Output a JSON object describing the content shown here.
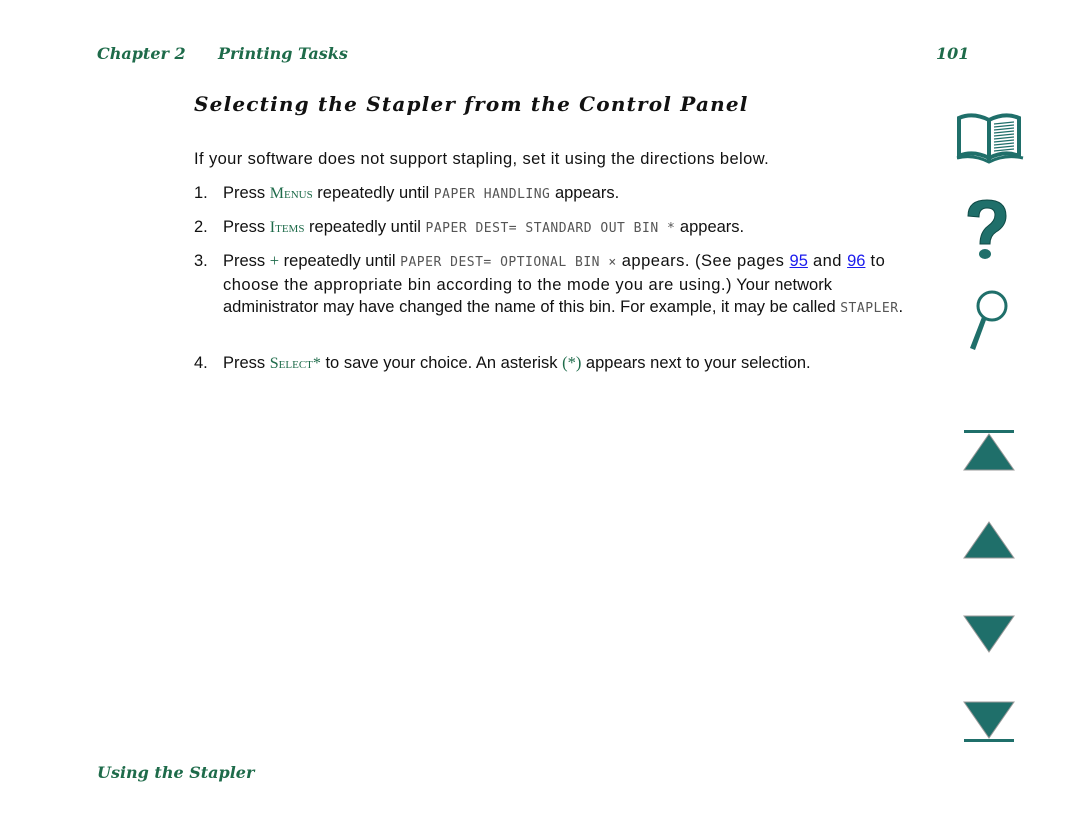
{
  "header": {
    "chapter": "Chapter 2",
    "section": "Printing Tasks",
    "page_number": "101"
  },
  "title": "Selecting the Stapler from the Control Panel",
  "intro": "If your software does not support stapling, set it using the directions below.",
  "steps": [
    {
      "num": "1.",
      "p1": "Press ",
      "key": "Menus",
      "p2": " repeatedly until ",
      "lcd": "PAPER HANDLING",
      "p3": " appears."
    },
    {
      "num": "2.",
      "p1": "Press ",
      "key": "Items",
      "p2": " repeatedly until ",
      "lcd": "PAPER DEST= STANDARD OUT BIN *",
      "p3": " appears."
    },
    {
      "num": "3.",
      "p1": "Press ",
      "key": "+",
      "p2": " repeatedly until ",
      "lcd": "PAPER DEST= OPTIONAL BIN ×",
      "p3": " appears. (See pages ",
      "link1": "95",
      "p4": " and ",
      "link2": "96",
      "p5": " to choose the appropriate bin according to the mode you are using.)",
      "p6": "Your network administrator may have changed the name of this bin. For example, it may be called ",
      "lcd2": "STAPLER",
      "p7": "."
    },
    {
      "num": "4.",
      "p1": "Press ",
      "key": "Select*",
      "p2": " to save your choice. An asterisk ",
      "asterisk": "(*)",
      "p3": " appears next to your selection."
    }
  ],
  "footer": "Using the Stapler",
  "nav_icons": [
    "book-icon",
    "help-icon",
    "search-icon",
    "first-page-icon",
    "previous-page-icon",
    "next-page-icon",
    "last-page-icon"
  ],
  "colors": {
    "accent_green": "#1e6b4a",
    "icon_teal": "#1f6f6a",
    "link_blue": "#1a1aee"
  }
}
